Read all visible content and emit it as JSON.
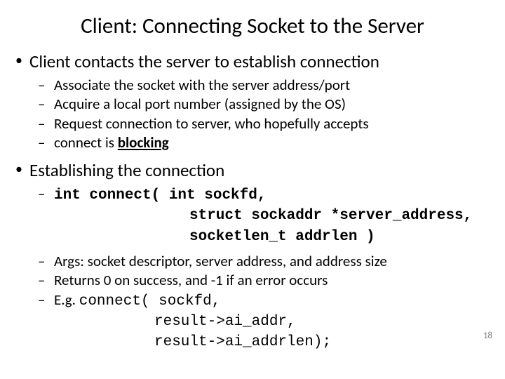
{
  "title": "Client: Connecting Socket to the Server",
  "section1": {
    "heading": "Client contacts the server to establish connection",
    "items": [
      "Associate the socket with the server address/port",
      "Acquire a local port number (assigned by the OS)",
      "Request connection to server, who hopefully accepts"
    ],
    "last_prefix": "connect is ",
    "last_bold": "blocking"
  },
  "section2": {
    "heading": "Establishing the connection",
    "sig_l1": "int connect( int sockfd,",
    "sig_l2": "struct sockaddr *server_address,",
    "sig_l3": "socketlen_t addrlen  )",
    "args": "Args: socket descriptor, server address, and address size",
    "returns": "Returns 0 on success, and -1 if an error occurs",
    "eg_prefix": "E.g. ",
    "eg_l1": "connect( sockfd,",
    "eg_l2": "result->ai_addr,",
    "eg_l3": "result->ai_addrlen);"
  },
  "page_number": "18"
}
